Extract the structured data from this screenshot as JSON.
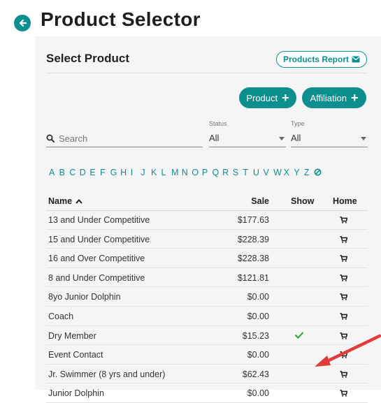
{
  "header": {
    "title": "Product Selector",
    "back_icon": "arrow-left-circle-icon"
  },
  "section": {
    "title": "Select Product"
  },
  "toolbar": {
    "report_label": "Products Report",
    "product_label": "Product",
    "affiliation_label": "Affiliation"
  },
  "filters": {
    "search_placeholder": "Search",
    "status_label": "Status",
    "status_value": "All",
    "type_label": "Type",
    "type_value": "All"
  },
  "alphabet": [
    "A",
    "B",
    "C",
    "D",
    "E",
    "F",
    "G",
    "H",
    "I",
    "J",
    "K",
    "L",
    "M",
    "N",
    "O",
    "P",
    "Q",
    "R",
    "S",
    "T",
    "U",
    "V",
    "W",
    "X",
    "Y",
    "Z"
  ],
  "table": {
    "columns": {
      "name": "Name",
      "sale": "Sale",
      "show": "Show",
      "home": "Home"
    },
    "rows": [
      {
        "name": "13 and Under Competitive",
        "sale": "$177.63",
        "show": false
      },
      {
        "name": "15 and Under Competitive",
        "sale": "$228.39",
        "show": false
      },
      {
        "name": "16 and Over Competitive",
        "sale": "$228.38",
        "show": false
      },
      {
        "name": "8 and Under Competitive",
        "sale": "$121.81",
        "show": false
      },
      {
        "name": "8yo Junior Dolphin",
        "sale": "$0.00",
        "show": false
      },
      {
        "name": "Coach",
        "sale": "$0.00",
        "show": false
      },
      {
        "name": "Dry Member",
        "sale": "$15.23",
        "show": true
      },
      {
        "name": "Event Contact",
        "sale": "$0.00",
        "show": false
      },
      {
        "name": "Jr. Swimmer (8 yrs and under)",
        "sale": "$62.43",
        "show": false
      },
      {
        "name": "Junior Dolphin",
        "sale": "$0.00",
        "show": false
      }
    ]
  },
  "colors": {
    "accent": "#0e8f8f",
    "check": "#3aa84a",
    "arrow": "#e23b3b"
  }
}
